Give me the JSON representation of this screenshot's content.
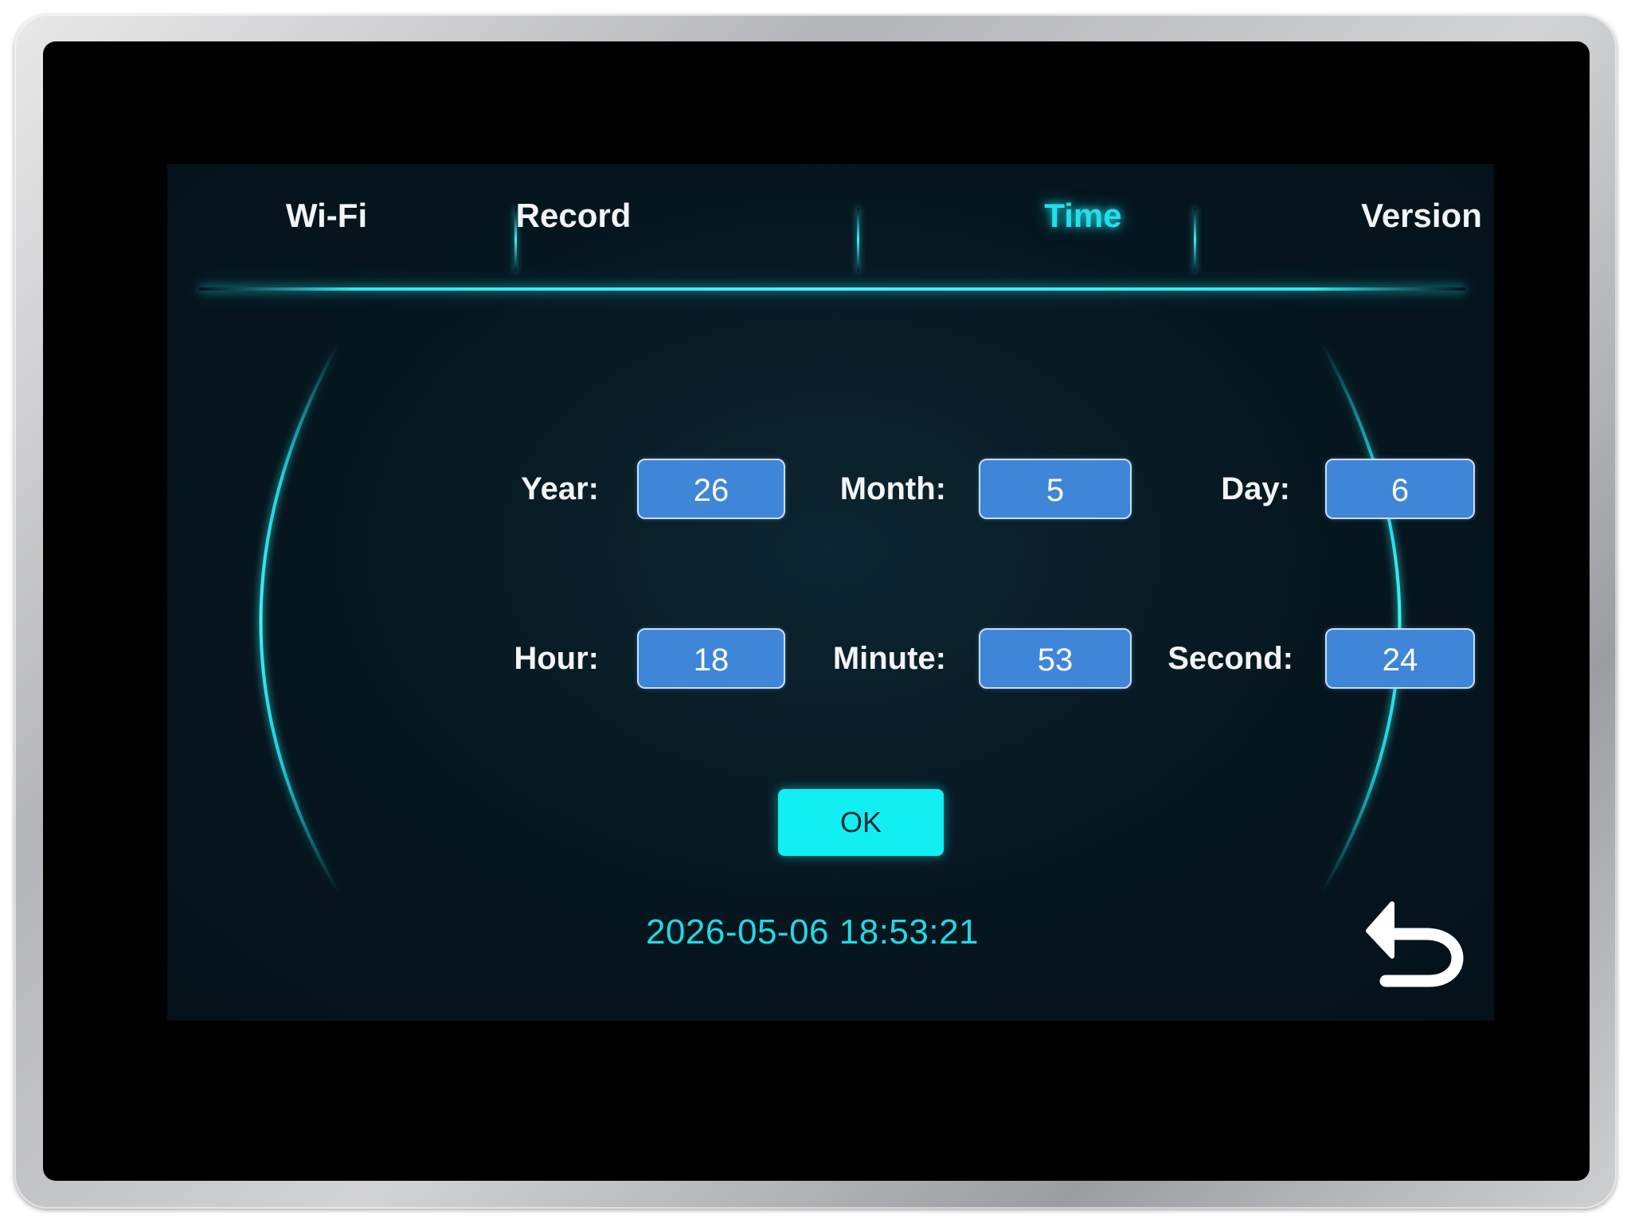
{
  "tabs": [
    {
      "label": "Wi-Fi",
      "active": false
    },
    {
      "label": "Record",
      "active": false
    },
    {
      "label": "Time",
      "active": true
    },
    {
      "label": "Version",
      "active": false
    }
  ],
  "fields": {
    "year": {
      "label": "Year:",
      "value": "26"
    },
    "month": {
      "label": "Month:",
      "value": "5"
    },
    "day": {
      "label": "Day:",
      "value": "6"
    },
    "hour": {
      "label": "Hour:",
      "value": "18"
    },
    "minute": {
      "label": "Minute:",
      "value": "53"
    },
    "second": {
      "label": "Second:",
      "value": "24"
    }
  },
  "ok_label": "OK",
  "current_datetime": "2026-05-06 18:53:21",
  "icons": {
    "back": "back-arrow-icon"
  },
  "colors": {
    "accent": "#22e0ea",
    "field_bg": "#3f86d9",
    "ok_bg": "#12eff2",
    "screen_bg": "#06161f"
  }
}
